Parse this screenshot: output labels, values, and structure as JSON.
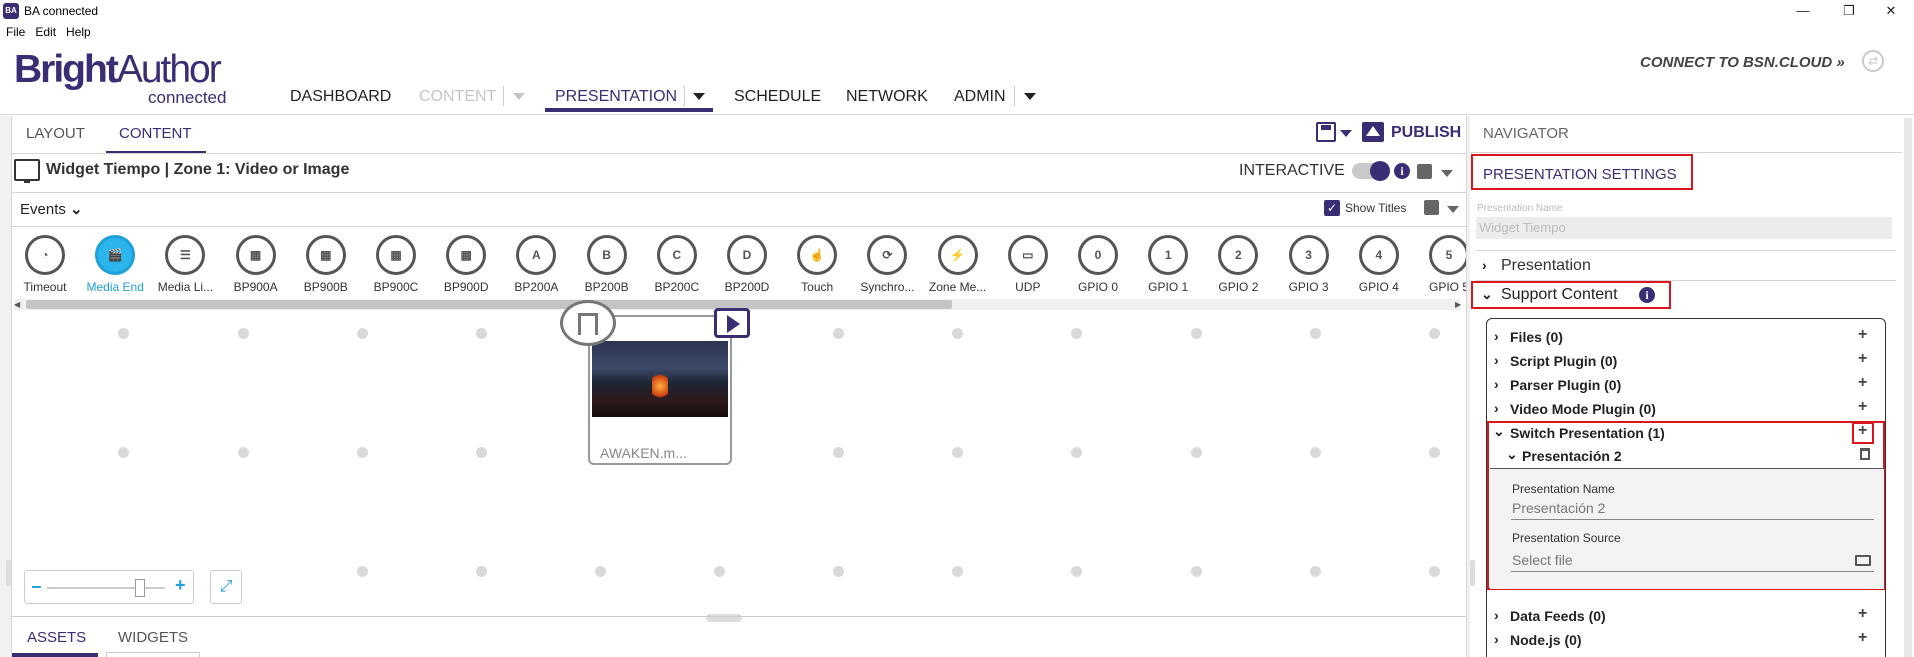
{
  "window": {
    "title": "BA connected",
    "app_icon_text": "BA",
    "controls": {
      "minimize": "—",
      "restore": "❐",
      "close": "✕"
    }
  },
  "menu": [
    "File",
    "Edit",
    "Help"
  ],
  "logo": {
    "word1": "Bright",
    "word2": "Author",
    "sub": "connected"
  },
  "topnav": {
    "items": [
      {
        "label": "DASHBOARD"
      },
      {
        "label": "CONTENT"
      },
      {
        "label": "PRESENTATION"
      },
      {
        "label": "SCHEDULE"
      },
      {
        "label": "NETWORK"
      },
      {
        "label": "ADMIN"
      }
    ],
    "connect_label": "CONNECT TO BSN.CLOUD »",
    "connect_icon": "sync-icon"
  },
  "editor": {
    "tabs": [
      {
        "label": "LAYOUT"
      },
      {
        "label": "CONTENT"
      }
    ],
    "publish_label": "PUBLISH",
    "zone_title": "Widget Tiempo | Zone 1: Video or Image",
    "interactive_label": "INTERACTIVE",
    "events_label": "Events",
    "show_titles_label": "Show Titles",
    "show_titles_check": "✓",
    "events": [
      {
        "label": "Timeout",
        "icon": "◔"
      },
      {
        "label": "Media End",
        "icon": "🎬"
      },
      {
        "label": "Media Li...",
        "icon": "☰"
      },
      {
        "label": "BP900A",
        "icon": "▦"
      },
      {
        "label": "BP900B",
        "icon": "▦"
      },
      {
        "label": "BP900C",
        "icon": "▦"
      },
      {
        "label": "BP900D",
        "icon": "▦"
      },
      {
        "label": "BP200A",
        "icon": "A"
      },
      {
        "label": "BP200B",
        "icon": "B"
      },
      {
        "label": "BP200C",
        "icon": "C"
      },
      {
        "label": "BP200D",
        "icon": "D"
      },
      {
        "label": "Touch",
        "icon": "☝"
      },
      {
        "label": "Synchro...",
        "icon": "⟳"
      },
      {
        "label": "Zone Me...",
        "icon": "⚡"
      },
      {
        "label": "UDP",
        "icon": "▭"
      },
      {
        "label": "GPIO 0",
        "icon": "0"
      },
      {
        "label": "GPIO 1",
        "icon": "1"
      },
      {
        "label": "GPIO 2",
        "icon": "2"
      },
      {
        "label": "GPIO 3",
        "icon": "3"
      },
      {
        "label": "GPIO 4",
        "icon": "4"
      },
      {
        "label": "GPIO 5",
        "icon": "5"
      }
    ],
    "media_state_name": "AWAKEN.m...",
    "zoom_minus": "−",
    "zoom_plus": "+",
    "expand_icon": "⤢",
    "bottom_tabs": [
      {
        "label": "ASSETS"
      },
      {
        "label": "WIDGETS"
      }
    ]
  },
  "navigator": {
    "title": "NAVIGATOR",
    "presentation_settings_label": "PRESENTATION SETTINGS",
    "presentation_name_label": "Presentation Name",
    "presentation_name_value": "Widget Tiempo",
    "presentation_section": "Presentation",
    "support_content_section": "Support Content",
    "support_items": [
      {
        "label": "Files (0)"
      },
      {
        "label": "Script Plugin (0)"
      },
      {
        "label": "Parser Plugin (0)"
      },
      {
        "label": "Video Mode Plugin (0)"
      },
      {
        "label": "Switch Presentation (1)"
      }
    ],
    "switch_item": {
      "name": "Presentación 2",
      "field_name_label": "Presentation Name",
      "field_name_value": "Presentación 2",
      "field_source_label": "Presentation Source",
      "field_source_placeholder": "Select file"
    },
    "more_items": [
      {
        "label": "Data Feeds (0)"
      },
      {
        "label": "Node.js (0)"
      }
    ]
  }
}
